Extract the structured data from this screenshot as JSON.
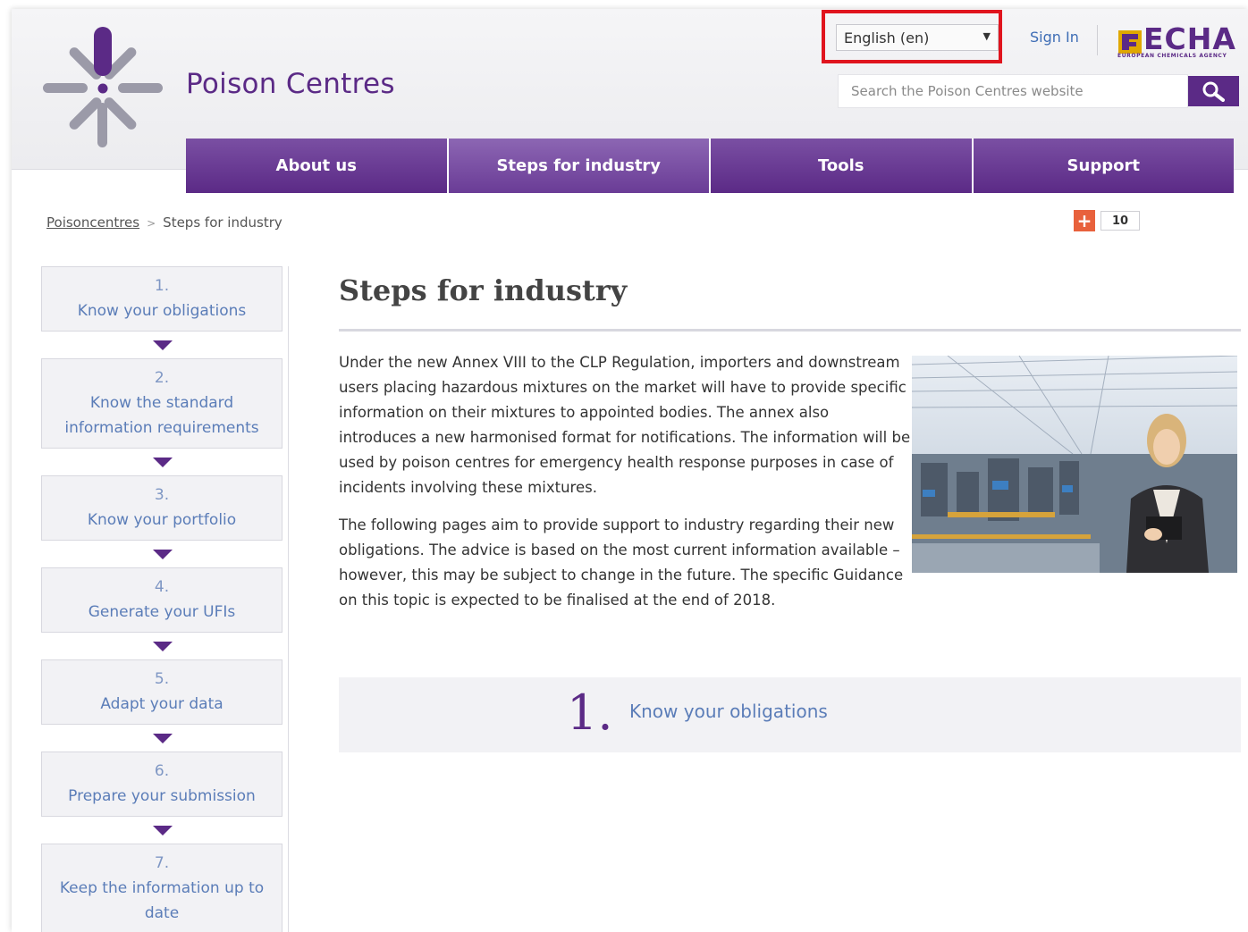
{
  "header": {
    "site_title": "Poison Centres",
    "language": "English (en)",
    "sign_in": "Sign In",
    "brand": "ECHA",
    "brand_sub": "EUROPEAN CHEMICALS AGENCY",
    "search_placeholder": "Search the Poison Centres website",
    "accent_color": "#5b2a86",
    "highlight_color": "#e0141e"
  },
  "nav": {
    "items": [
      {
        "label": "About us"
      },
      {
        "label": "Steps for industry"
      },
      {
        "label": "Tools"
      },
      {
        "label": "Support"
      }
    ],
    "active": "Steps for industry"
  },
  "breadcrumb": {
    "home": "Poisoncentres",
    "separator": ">",
    "current": "Steps for industry"
  },
  "share": {
    "icon": "plus-share-icon",
    "count": "10"
  },
  "sidebar": {
    "steps": [
      {
        "num": "1.",
        "label": "Know your obligations"
      },
      {
        "num": "2.",
        "label": "Know the standard information requirements"
      },
      {
        "num": "3.",
        "label": "Know your portfolio"
      },
      {
        "num": "4.",
        "label": "Generate your UFIs"
      },
      {
        "num": "5.",
        "label": "Adapt your data"
      },
      {
        "num": "6.",
        "label": "Prepare your submission"
      },
      {
        "num": "7.",
        "label": "Keep the information up to date"
      }
    ]
  },
  "main": {
    "title": "Steps for industry",
    "paragraph1": "Under the new Annex VIII to the CLP Regulation, importers and downstream users placing hazardous mixtures on the market will have to provide specific information on their mixtures to appointed bodies. The annex also introduces a new harmonised format for notifications. The information will be used by poison centres for emergency health response purposes in case of incidents involving these mixtures.",
    "paragraph2": "The following pages aim to provide support to industry regarding their new obligations. The advice is based on the most current information available – however, this may be subject to change in the future. The specific Guidance on this topic is expected to be finalised at the end of 2018.",
    "banner_num": "1.",
    "banner_label": "Know your obligations"
  }
}
